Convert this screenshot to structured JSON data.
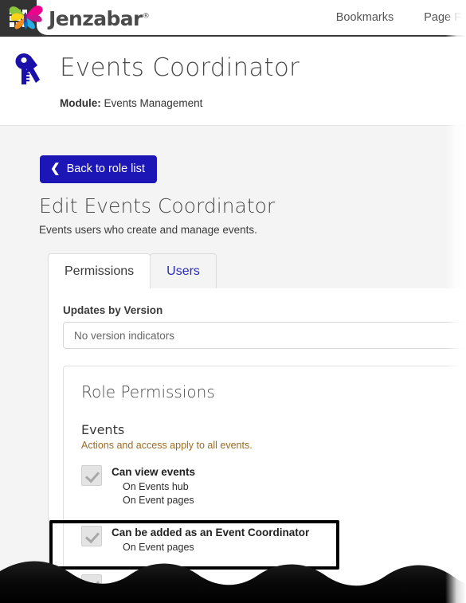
{
  "topbar": {
    "waffle_label": "App menu",
    "brand": "Jenzabar",
    "brand_mark": "®",
    "nav": [
      {
        "label": "Bookmarks"
      },
      {
        "label": "Page F"
      }
    ]
  },
  "pagehead": {
    "icon": "keys-icon",
    "title": "Events Coordinator",
    "module_label": "Module:",
    "module_value": "Events Management"
  },
  "content": {
    "back_button": "Back to role list",
    "back_chevron": "❮",
    "edit_title": "Edit Events Coordinator",
    "edit_description": "Events users who create and manage events.",
    "tabs": [
      {
        "label": "Permissions",
        "active": true
      },
      {
        "label": "Users",
        "active": false
      }
    ],
    "updates_label": "Updates by Version",
    "updates_value": "No version indicators",
    "permissions_card": {
      "heading": "Role Permissions",
      "group_title": "Events",
      "group_note": "Actions and access apply to all events.",
      "items": [
        {
          "label": "Can view events",
          "checked": true,
          "disabled": true,
          "sub_items": [
            "On Events hub",
            "On Event pages"
          ]
        },
        {
          "label": "Can be added as an Event Coordinator",
          "checked": true,
          "disabled": true,
          "sub_items": [
            "On Event pages"
          ],
          "highlighted": true
        }
      ]
    }
  },
  "colors": {
    "brand_blue": "#1b16b5",
    "topbar_dark": "#333333",
    "link_blue": "#2b2bb5",
    "note_brown": "#9c6b22",
    "page_bg": "#f4f4f4",
    "highlight_outline": "#000000"
  }
}
